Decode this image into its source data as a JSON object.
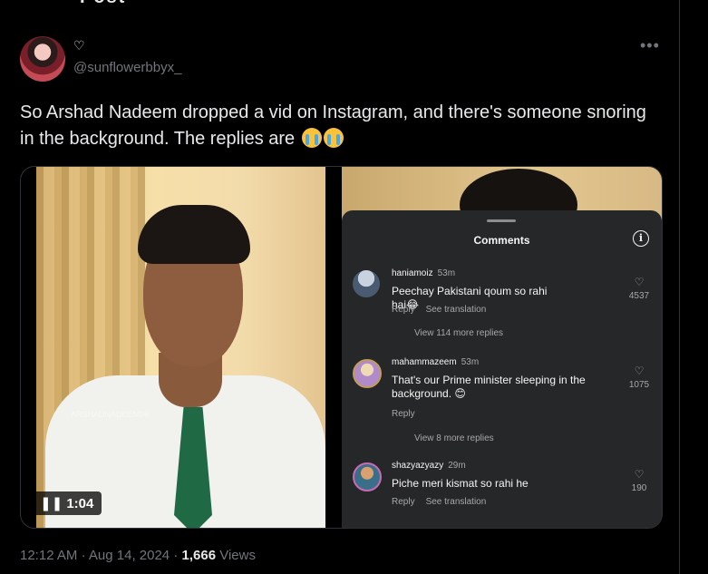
{
  "top_cut_text": "Post",
  "author": {
    "name_icon": "♡",
    "handle": "@sunflowerbbyx_"
  },
  "more_label": "•••",
  "post": {
    "text": "So Arshad Nadeem dropped a vid on Instagram, and there's someone snoring in the background. The replies are"
  },
  "emoji_icon": "loudly-crying-face",
  "video": {
    "duration": "1:04",
    "watermark": "ARSHADNADEEM96"
  },
  "comments_sheet": {
    "title": "Comments",
    "comments": [
      {
        "user": "haniamoiz",
        "time": "53m",
        "text": "Peechay Pakistani qoum so rahi hai😂",
        "reply": "Reply",
        "translate": "See translation",
        "likes": "4537",
        "view_more": "View 114 more replies"
      },
      {
        "user": "mahammazeem",
        "time": "53m",
        "text": "That's our Prime minister sleeping in the background. 😊",
        "reply": "Reply",
        "translate": "",
        "likes": "1075",
        "view_more": "View 8 more replies"
      },
      {
        "user": "shazyazyazy",
        "time": "29m",
        "text": "Piche meri kismat so rahi he",
        "reply": "Reply",
        "translate": "See translation",
        "likes": "190",
        "view_more": ""
      }
    ]
  },
  "meta": {
    "time": "12:12 AM",
    "sep": "·",
    "date": "Aug 14, 2024",
    "views_count": "1,666",
    "views_label": "Views"
  },
  "colors": {
    "background": "#000000",
    "secondary_text": "#71767b",
    "border": "#2f3336"
  }
}
